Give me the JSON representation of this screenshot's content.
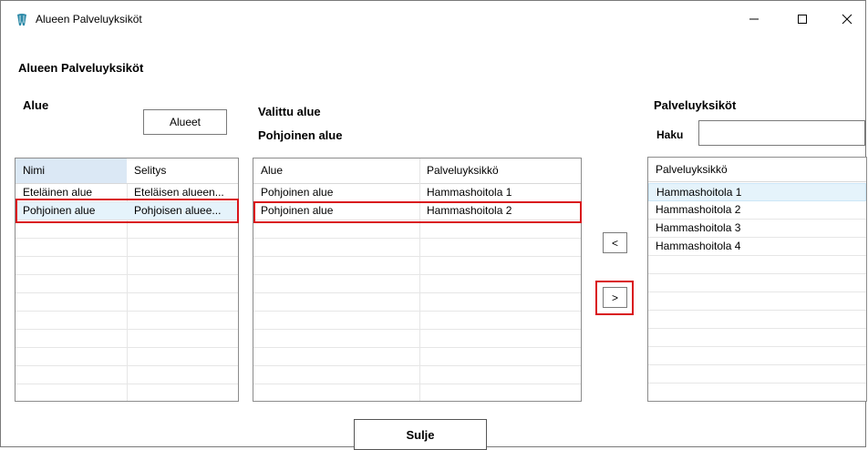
{
  "window": {
    "title": "Alueen Palveluyksiköt",
    "icon": "tooth-icon"
  },
  "page_title": "Alueen Palveluyksiköt",
  "left": {
    "heading": "Alue",
    "button_label": "Alueet",
    "columns": [
      "Nimi",
      "Selitys"
    ],
    "rows": [
      [
        "Eteläinen alue",
        "Eteläisen alueen..."
      ],
      [
        "Pohjoinen alue",
        "Pohjoisen aluee..."
      ]
    ]
  },
  "middle": {
    "heading": "Valittu alue",
    "subheading": "Pohjoinen alue",
    "columns": [
      "Alue",
      "Palveluyksikkö"
    ],
    "rows": [
      [
        "Pohjoinen alue",
        "Hammashoitola 1"
      ],
      [
        "Pohjoinen alue",
        "Hammashoitola 2"
      ]
    ]
  },
  "transfer": {
    "left_label": "<",
    "right_label": ">"
  },
  "right": {
    "heading": "Palveluyksiköt",
    "search_label": "Haku",
    "search_value": "",
    "column": "Palveluyksikkö",
    "rows": [
      "Hammashoitola 1",
      "Hammashoitola 2",
      "Hammashoitola 3",
      "Hammashoitola 4"
    ]
  },
  "close_button": "Sulje",
  "colors": {
    "highlight": "#d9141b",
    "selected_row": "#e5f3fb",
    "header_selected": "#dbe8f5"
  }
}
